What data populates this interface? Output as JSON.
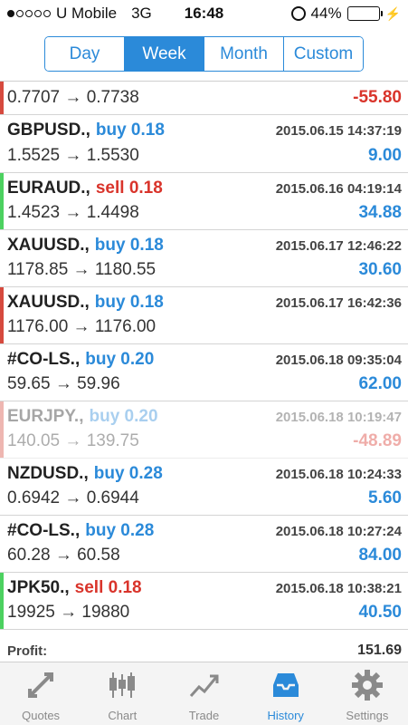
{
  "status": {
    "carrier": "U Mobile",
    "network": "3G",
    "time": "16:48",
    "battery": "44%",
    "battery_level": 0.44
  },
  "period_tabs": [
    {
      "label": "Day",
      "active": false
    },
    {
      "label": "Week",
      "active": true
    },
    {
      "label": "Month",
      "active": false
    },
    {
      "label": "Custom",
      "active": false
    }
  ],
  "trades": [
    {
      "symbol": "",
      "side": "",
      "side_type": "",
      "volume": "",
      "time": "",
      "open": "0.7707",
      "close": "0.7738",
      "profit": "-55.80",
      "profit_type": "neg",
      "indicator": "red",
      "partial": true
    },
    {
      "symbol": "GBPUSD.,",
      "side": "buy",
      "side_type": "buy",
      "volume": "0.18",
      "time": "2015.06.15 14:37:19",
      "open": "1.5525",
      "close": "1.5530",
      "profit": "9.00",
      "profit_type": "pos",
      "indicator": "none"
    },
    {
      "symbol": "EURAUD.,",
      "side": "sell",
      "side_type": "sell",
      "volume": "0.18",
      "time": "2015.06.16 04:19:14",
      "open": "1.4523",
      "close": "1.4498",
      "profit": "34.88",
      "profit_type": "pos",
      "indicator": "green"
    },
    {
      "symbol": "XAUUSD.,",
      "side": "buy",
      "side_type": "buy",
      "volume": "0.18",
      "time": "2015.06.17 12:46:22",
      "open": "1178.85",
      "close": "1180.55",
      "profit": "30.60",
      "profit_type": "pos",
      "indicator": "none"
    },
    {
      "symbol": "XAUUSD.,",
      "side": "buy",
      "side_type": "buy",
      "volume": "0.18",
      "time": "2015.06.17 16:42:36",
      "open": "1176.00",
      "close": "1176.00",
      "profit": "",
      "profit_type": "pos",
      "indicator": "red"
    },
    {
      "symbol": "#CO-LS.,",
      "side": "buy",
      "side_type": "buy",
      "volume": "0.20",
      "time": "2015.06.18 09:35:04",
      "open": "59.65",
      "close": "59.96",
      "profit": "62.00",
      "profit_type": "pos",
      "indicator": "none"
    },
    {
      "symbol": "EURJPY.,",
      "side": "buy",
      "side_type": "buy",
      "volume": "0.20",
      "time": "2015.06.18 10:19:47",
      "open": "140.05",
      "close": "139.75",
      "profit": "-48.89",
      "profit_type": "neg",
      "indicator": "red",
      "faded": true
    },
    {
      "symbol": "NZDUSD.,",
      "side": "buy",
      "side_type": "buy",
      "volume": "0.28",
      "time": "2015.06.18 10:24:33",
      "open": "0.6942",
      "close": "0.6944",
      "profit": "5.60",
      "profit_type": "pos",
      "indicator": "none"
    },
    {
      "symbol": "#CO-LS.,",
      "side": "buy",
      "side_type": "buy",
      "volume": "0.28",
      "time": "2015.06.18 10:27:24",
      "open": "60.28",
      "close": "60.58",
      "profit": "84.00",
      "profit_type": "pos",
      "indicator": "none"
    },
    {
      "symbol": "JPK50.,",
      "side": "sell",
      "side_type": "sell",
      "volume": "0.18",
      "time": "2015.06.18 10:38:21",
      "open": "19925",
      "close": "19880",
      "profit": "40.50",
      "profit_type": "pos",
      "indicator": "green"
    }
  ],
  "summary": {
    "label": "Profit:",
    "value": "151.69"
  },
  "tabbar": [
    {
      "label": "Quotes",
      "icon": "quotes-icon",
      "active": false
    },
    {
      "label": "Chart",
      "icon": "candlestick-chart-icon",
      "active": false
    },
    {
      "label": "Trade",
      "icon": "trade-trend-icon",
      "active": false
    },
    {
      "label": "History",
      "icon": "history-inbox-icon",
      "active": true
    },
    {
      "label": "Settings",
      "icon": "gear-icon",
      "active": false
    }
  ],
  "colors": {
    "accent": "#2b8ad9",
    "loss": "#d9342b",
    "sell_bar": "#d64a3e",
    "buy_bar": "#4cd160"
  }
}
